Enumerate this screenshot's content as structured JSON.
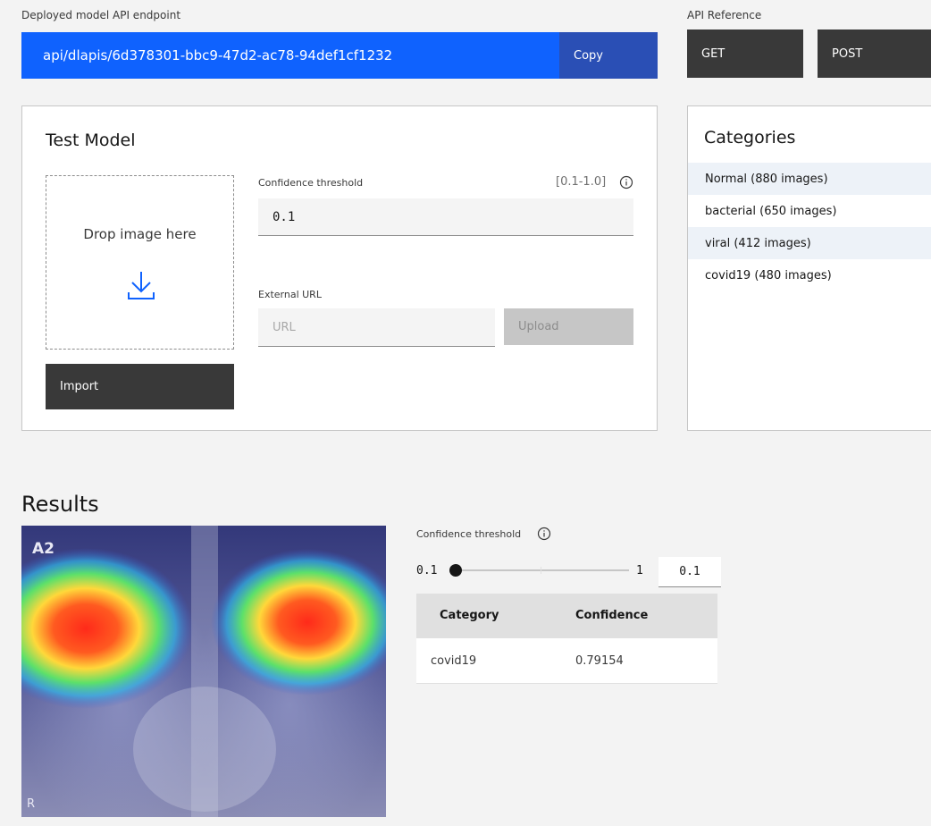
{
  "endpoint": {
    "label": "Deployed model API endpoint",
    "value": "api/dlapis/6d378301-bbc9-47d2-ac78-94def1cf1232",
    "copy_label": "Copy"
  },
  "api_reference": {
    "label": "API Reference",
    "get_label": "GET",
    "post_label": "POST"
  },
  "test_model": {
    "title": "Test Model",
    "drop_label": "Drop image here",
    "import_label": "Import",
    "threshold_label": "Confidence threshold",
    "threshold_range": "[0.1-1.0]",
    "threshold_value": "0.1",
    "external_url_label": "External URL",
    "url_placeholder": "URL",
    "upload_label": "Upload"
  },
  "categories": {
    "title": "Categories",
    "items": [
      {
        "label": "Normal (880 images)"
      },
      {
        "label": "bacterial (650 images)"
      },
      {
        "label": "viral (412 images)"
      },
      {
        "label": "covid19 (480 images)"
      }
    ]
  },
  "results": {
    "title": "Results",
    "image_label_top": "A2",
    "image_label_bottom": "R",
    "threshold_label": "Confidence threshold",
    "slider_min": "0.1",
    "slider_max": "1",
    "slider_value": "0.1",
    "slider_fraction": 0.0,
    "table": {
      "headers": [
        "Category",
        "Confidence"
      ],
      "rows": [
        {
          "category": "covid19",
          "confidence": "0.79154"
        }
      ]
    }
  },
  "colors": {
    "primary": "#0f62fe",
    "copy_bg": "#2a4fb5",
    "dark_button": "#393939",
    "disabled": "#c6c6c6"
  },
  "icons": [
    "download-icon",
    "info-icon"
  ]
}
